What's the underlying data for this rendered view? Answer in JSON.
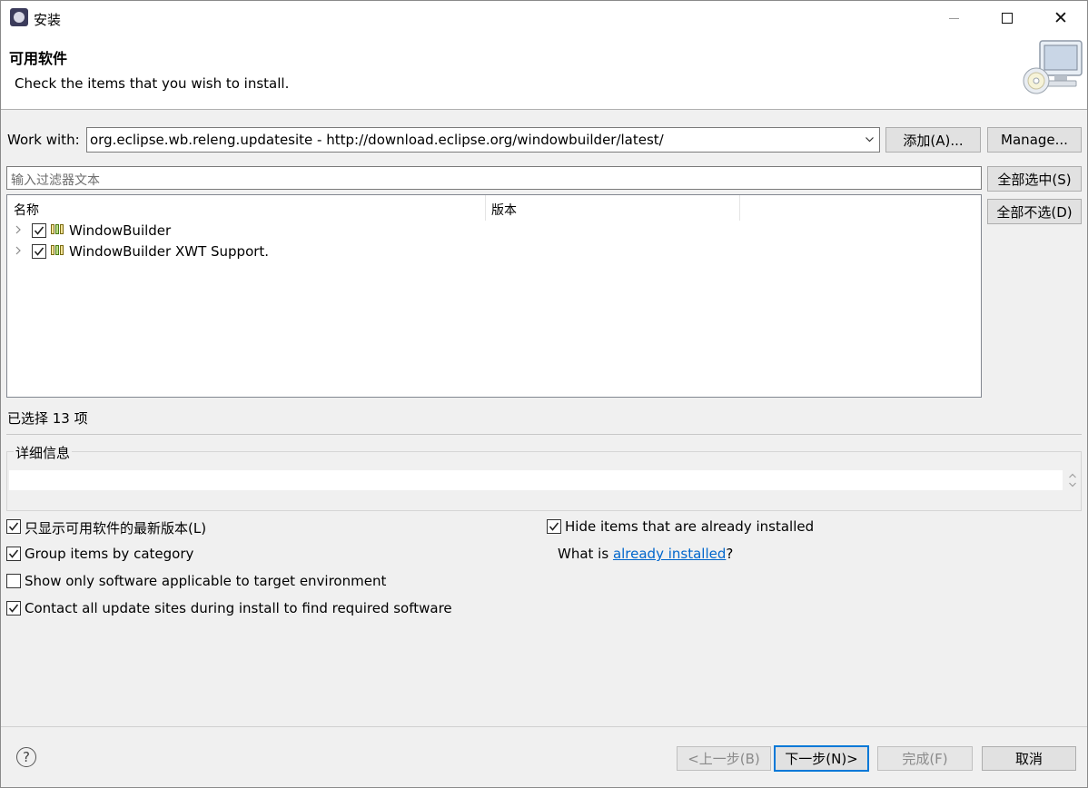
{
  "window": {
    "title": "安装"
  },
  "header": {
    "title": "可用软件",
    "description": "Check the items that you wish to install."
  },
  "work_with": {
    "label": "Work with:",
    "value": "org.eclipse.wb.releng.updatesite - http://download.eclipse.org/windowbuilder/latest/",
    "add_button": "添加(A)...",
    "manage_button": "Manage..."
  },
  "filter": {
    "placeholder": "输入过滤器文本"
  },
  "side_buttons": {
    "select_all": "全部选中(S)",
    "deselect_all": "全部不选(D)"
  },
  "tree": {
    "columns": [
      "名称",
      "版本"
    ],
    "items": [
      {
        "name": "WindowBuilder",
        "version": "",
        "checked": true
      },
      {
        "name": "WindowBuilder XWT Support.",
        "version": "",
        "checked": true
      }
    ]
  },
  "selection_status": "已选择 13 项",
  "details": {
    "title": "详细信息",
    "text": ""
  },
  "options": {
    "latest_only": {
      "label": "只显示可用软件的最新版本(L)",
      "checked": true
    },
    "group_by_category": {
      "label": "Group items by category",
      "checked": true
    },
    "target_env": {
      "label": "Show only software applicable to target environment",
      "checked": false
    },
    "contact_sites": {
      "label": "Contact all update sites during install to find required software",
      "checked": true
    },
    "hide_installed": {
      "label": "Hide items that are already installed",
      "checked": true
    },
    "what_is_prefix": "What is ",
    "what_is_link": "already installed",
    "what_is_suffix": "?"
  },
  "footer": {
    "help_glyph": "?",
    "back": "<上一步(B)",
    "next": "下一步(N)>",
    "finish": "完成(F)",
    "cancel": "取消"
  },
  "colors": {
    "accent": "#0078d7",
    "link": "#0066cc",
    "dialog_bg": "#f0f0f0"
  }
}
